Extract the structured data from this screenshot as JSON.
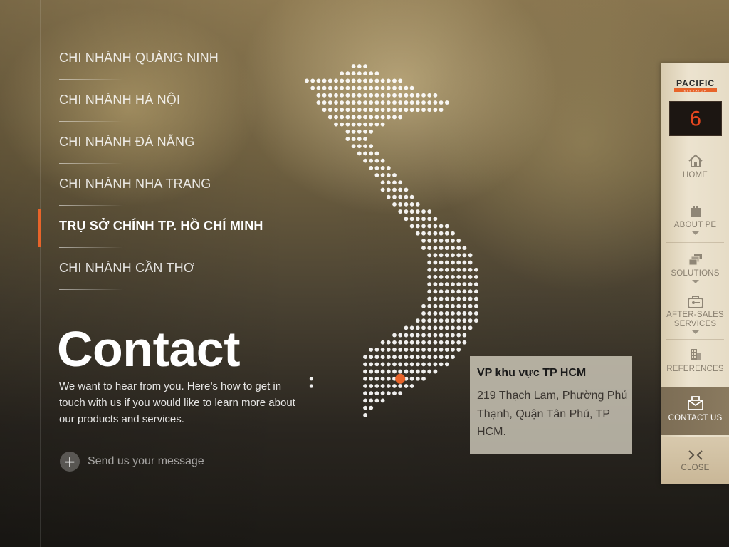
{
  "branches": {
    "items": [
      {
        "label": "CHI NHÁNH QUẢNG NINH"
      },
      {
        "label": "CHI NHÁNH HÀ NỘI"
      },
      {
        "label": "CHI NHÁNH ĐÀ NẴNG"
      },
      {
        "label": "CHI NHÁNH NHA TRANG"
      },
      {
        "label": "TRỤ SỞ CHÍNH TP. HỒ CHÍ MINH",
        "active": true
      },
      {
        "label": "CHI NHÁNH CẦN THƠ"
      }
    ]
  },
  "contact": {
    "title": "Contact",
    "description": "We want to hear from you. Here’s how to get in touch with us if you would like to learn more about our products and services.",
    "send_message": "Send us your message"
  },
  "office": {
    "name": "VP khu vực TP HCM",
    "address": "219 Thạch Lam, Phường Phú Thạnh, Quận Tân Phú, TP HCM."
  },
  "brand": {
    "logo_text": "PACIFIC",
    "logo_subtext": "ELEVATOR",
    "floor_number": "6",
    "accent_color": "#e8642a"
  },
  "nav": {
    "home": "HOME",
    "about": "ABOUT PE",
    "solutions": "SOLUTIONS",
    "after_sales_1": "AFTER-SALES",
    "after_sales_2": "SERVICES",
    "references": "REFERENCES",
    "contact": "CONTACT US",
    "close": "CLOSE"
  }
}
